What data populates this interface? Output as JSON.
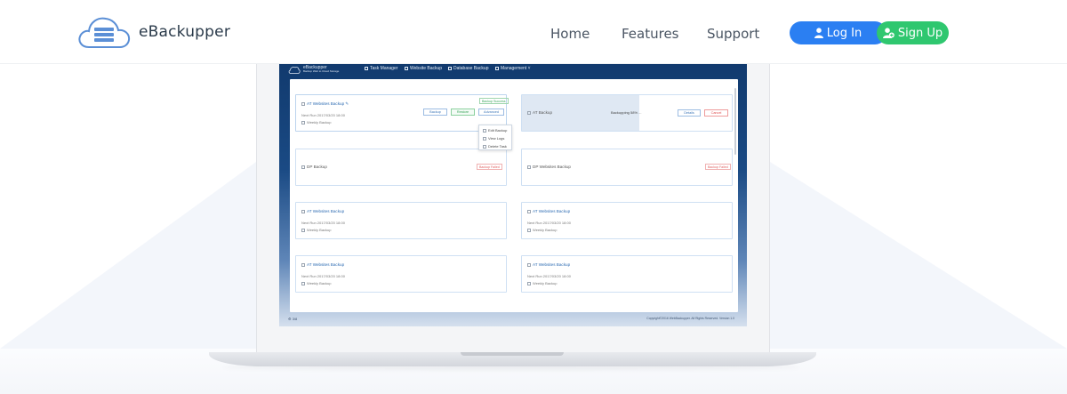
{
  "header": {
    "brand": "eBackupper",
    "nav": [
      {
        "label": "Home"
      },
      {
        "label": "Features"
      },
      {
        "label": "Support"
      }
    ],
    "login_label": "Log In",
    "signup_label": "Sign Up",
    "colors": {
      "login": "#2b7ff2",
      "signup": "#2fc76f",
      "logo": "#5b8fd6"
    }
  },
  "app": {
    "brand_line1": "eBackupper",
    "brand_line2": "Backup Web to Cloud Storage",
    "nav": [
      {
        "label": "Task Manager"
      },
      {
        "label": "Website Backup"
      },
      {
        "label": "Database Backup"
      },
      {
        "label": "Management ˅"
      }
    ],
    "cards": [
      {
        "title": "AT Websites Backup ✎",
        "next": "Next Run 2017/03/20 18:00",
        "schedule": "Weekly Backup",
        "tag": "Backup Success",
        "buttons": [
          "Backup",
          "Restore",
          "Advanced"
        ]
      },
      {
        "title": "AT Backup",
        "status": "Backupping 58% ...",
        "buttons": [
          "Details",
          "Cancel"
        ]
      },
      {
        "title": "DP Backup",
        "tag": "Backup Failed"
      },
      {
        "title": "DP Websites Backup",
        "tag": "Backup Failed"
      },
      {
        "title": "AT Websites Backup",
        "next": "Next Run 2017/03/20 18:00",
        "schedule": "Weekly Backup"
      },
      {
        "title": "AT Websites Backup",
        "next": "Next Run 2017/03/20 18:00",
        "schedule": "Weekly Backup"
      },
      {
        "title": "AT Websites Backup",
        "next": "Next Run 2017/03/20 18:00",
        "schedule": "Weekly Backup"
      },
      {
        "title": "AT Websites Backup",
        "next": "Next Run 2017/03/20 18:00",
        "schedule": "Weekly Backup"
      }
    ],
    "dropdown": [
      "Edit Backup",
      "View Logs",
      "Delete Task"
    ],
    "footer_left": "⚙ 3/8",
    "footer_right": "Copyright©2016 WebBackupper. All Rights Reserved. Version 1.0"
  }
}
